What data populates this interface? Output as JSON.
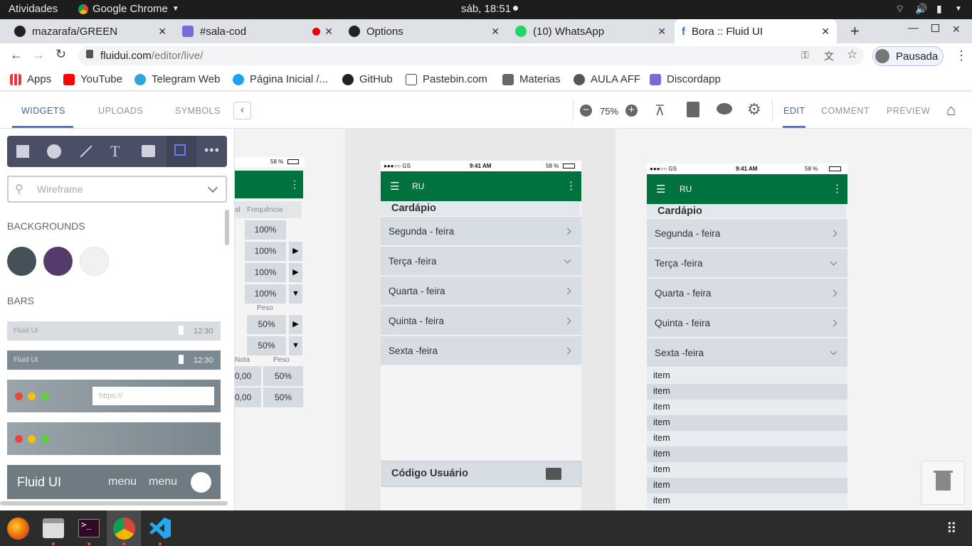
{
  "system": {
    "activities": "Atividades",
    "app_name": "Google Chrome",
    "clock": "sáb, 18:51"
  },
  "tabs": [
    {
      "title": "mazarafa/GREEN"
    },
    {
      "title": "#sala-cod"
    },
    {
      "title": "Options"
    },
    {
      "title": "(10) WhatsApp"
    },
    {
      "title": "Bora :: Fluid UI",
      "active": true
    }
  ],
  "address": {
    "host": "fluidui.com",
    "path": "/editor/live/"
  },
  "profile": {
    "label": "Pausada"
  },
  "bookmarks": [
    "Apps",
    "YouTube",
    "Telegram Web",
    "Página Inicial /...",
    "GitHub",
    "Pastebin.com",
    "Materias",
    "AULA AFF",
    "Discordapp"
  ],
  "editor": {
    "left_tabs": [
      "WIDGETS",
      "UPLOADS",
      "SYMBOLS"
    ],
    "zoom": "75%",
    "right_tabs": [
      "EDIT",
      "COMMENT",
      "PREVIEW"
    ],
    "search_placeholder": "Wireframe",
    "section_backgrounds": "BACKGROUNDS",
    "section_bars": "BARS",
    "bar1": {
      "title": "Fluid UI",
      "time": "12:30"
    },
    "bar2": {
      "title": "Fluid UI",
      "time": "12:30"
    },
    "url_placeholder": "https://",
    "bar5": {
      "title": "Fluid UI",
      "menu1": "menu",
      "menu2": "menu"
    },
    "bg_colors": [
      "#455159",
      "#533b6d",
      "#f1f1f1"
    ]
  },
  "phone_left": {
    "battery": "58 %",
    "headers": [
      "al",
      "Frequência"
    ],
    "rows": [
      "100%",
      "100%",
      "100%",
      "100%"
    ],
    "peso_label": "Peso",
    "peso_rows": [
      "50%",
      "50%"
    ],
    "table_headers": [
      "Nota",
      "Peso"
    ],
    "table_rows": [
      [
        "0,00",
        "50%"
      ],
      [
        "0,00",
        "50%"
      ]
    ]
  },
  "phone_mid": {
    "carrier": "●●●○○ GS",
    "time": "9:41 AM",
    "battery": "58 %",
    "title": "RU",
    "section": "Cardápio",
    "days": [
      "Segunda - feira",
      "Terça -feira",
      "Quarta - feira",
      "Quinta - feira",
      "Sexta -feira"
    ],
    "footer": "Código Usuário"
  },
  "phone_right": {
    "carrier": "●●●○○ GS",
    "time": "9:41 AM",
    "battery": "58 %",
    "title": "RU",
    "section": "Cardápio",
    "days": [
      "Segunda - feira",
      "Terça -feira",
      "Quarta - feira",
      "Quinta - feira",
      "Sexta -feira"
    ],
    "items": [
      "item",
      "item",
      "item",
      "item",
      "item",
      "item",
      "item",
      "item",
      "item"
    ]
  }
}
